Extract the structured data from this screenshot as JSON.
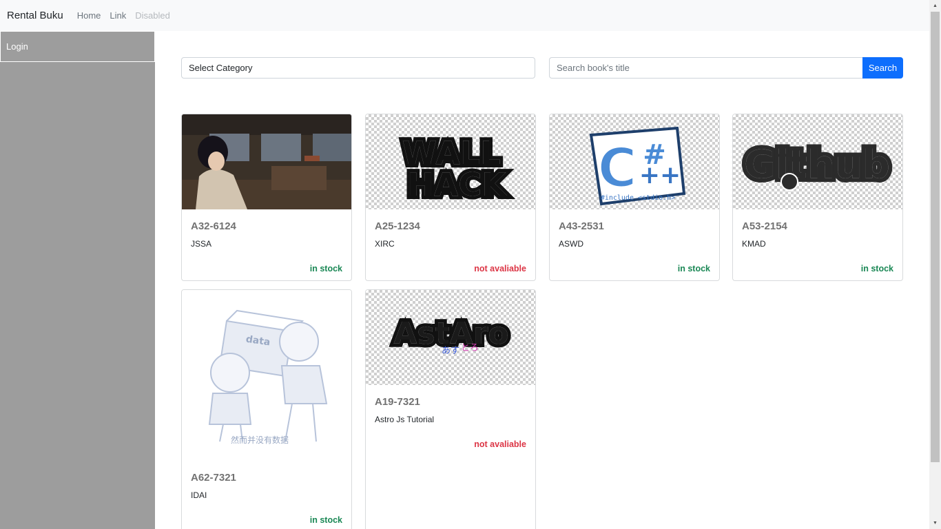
{
  "navbar": {
    "brand": "Rental Buku",
    "links": [
      "Home",
      "Link",
      "Disabled"
    ]
  },
  "sidebar": {
    "items": [
      {
        "label": "Login"
      }
    ]
  },
  "filters": {
    "category_label": "Select Category",
    "search_placeholder": "Search book's title",
    "search_button": "Search"
  },
  "books": [
    {
      "code": "A32-6124",
      "title": "JSSA",
      "status": "in stock",
      "cover": "anime-train-illustration"
    },
    {
      "code": "A25-1234",
      "title": "XIRC",
      "status": "not avaliable",
      "cover": "WALL HACK"
    },
    {
      "code": "A43-2531",
      "title": "ASWD",
      "status": "in stock",
      "cover": "C++ #include <stdio.h>"
    },
    {
      "code": "A53-2154",
      "title": "KMAD",
      "status": "in stock",
      "cover": "Github"
    },
    {
      "code": "A62-7321",
      "title": "IDAI",
      "status": "in stock",
      "cover": "然而并没有数据"
    },
    {
      "code": "A19-7321",
      "title": "Astro Js Tutorial",
      "status": "not avaliable",
      "cover": "AstAro あすとろ"
    }
  ],
  "colors": {
    "in_stock": "#198754",
    "not_available": "#dc3545",
    "primary": "#0d6efd",
    "sidebar": "#9d9d9d"
  }
}
